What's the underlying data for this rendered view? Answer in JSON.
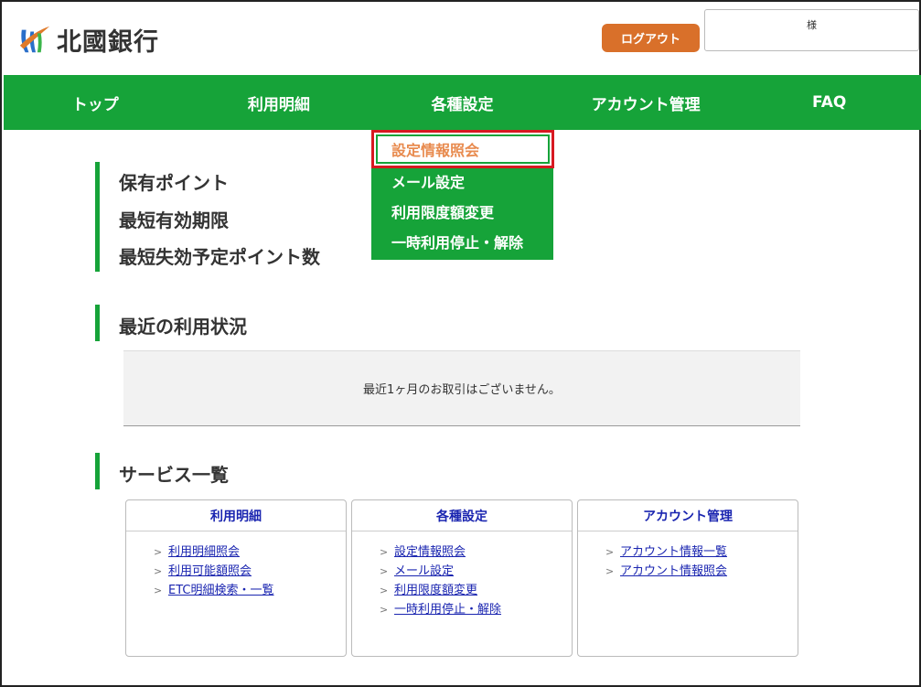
{
  "header": {
    "bank_name": "北國銀行",
    "logout_label": "ログアウト",
    "user_suffix": "様"
  },
  "nav": {
    "items": [
      {
        "label": "トップ"
      },
      {
        "label": "利用明細"
      },
      {
        "label": "各種設定"
      },
      {
        "label": "アカウント管理"
      },
      {
        "label": "FAQ"
      }
    ]
  },
  "dropdown": {
    "items": [
      {
        "label": "設定情報照会",
        "active": true
      },
      {
        "label": "メール設定"
      },
      {
        "label": "利用限度額変更"
      },
      {
        "label": "一時利用停止・解除"
      }
    ]
  },
  "points": {
    "held": "保有ポイント",
    "earliest_expiry": "最短有効期限",
    "earliest_expiring_points": "最短失効予定ポイント数"
  },
  "recent": {
    "title": "最近の利用状況",
    "empty_message": "最近1ヶ月のお取引はございません。"
  },
  "services": {
    "title": "サービス一覧",
    "cards": [
      {
        "title": "利用明細",
        "links": [
          "利用明細照会",
          "利用可能額照会",
          "ETC明細検索・一覧"
        ]
      },
      {
        "title": "各種設定",
        "links": [
          "設定情報照会",
          "メール設定",
          "利用限度額変更",
          "一時利用停止・解除"
        ]
      },
      {
        "title": "アカウント管理",
        "links": [
          "アカウント情報一覧",
          "アカウント情報照会"
        ]
      }
    ]
  },
  "colors": {
    "brand_green": "#16a339",
    "logout_orange": "#d9702a",
    "link_blue": "#1a25b0",
    "highlight_red": "#d71921"
  }
}
